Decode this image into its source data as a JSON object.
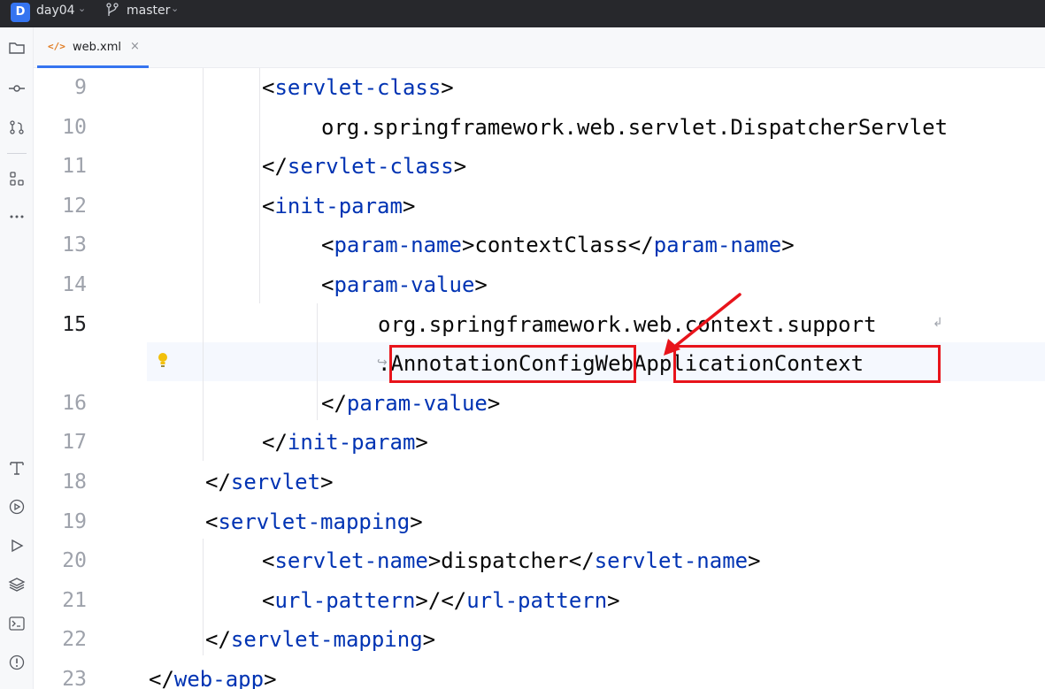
{
  "titlebar": {
    "project_badge": "D",
    "project_name": "day04",
    "branch": "master"
  },
  "tabs": [
    {
      "icon": "</>",
      "label": "web.xml",
      "close": "×"
    }
  ],
  "editor": {
    "line_numbers": [
      "9",
      "10",
      "11",
      "12",
      "13",
      "14",
      "15",
      "",
      "16",
      "17",
      "18",
      "19",
      "20",
      "21",
      "22",
      "23"
    ],
    "lines": [
      {
        "n": "9",
        "open": "<",
        "tag": "servlet-class",
        "close": ">"
      },
      {
        "n": "10",
        "text": "org.springframework.web.servlet.DispatcherServlet"
      },
      {
        "n": "11",
        "open": "</",
        "tag": "servlet-class",
        "close": ">"
      },
      {
        "n": "12",
        "open": "<",
        "tag": "init-param",
        "close": ">"
      },
      {
        "n": "13",
        "t1": "param-name",
        "text": "contextClass",
        "t2": "param-name"
      },
      {
        "n": "14",
        "open": "<",
        "tag": "param-value",
        "close": ">"
      },
      {
        "n": "15",
        "text": "org.springframework.web.context.support"
      },
      {
        "n": "",
        "text": ".AnnotationConfigWebApplicationContext"
      },
      {
        "n": "16",
        "open": "</",
        "tag": "param-value",
        "close": ">"
      },
      {
        "n": "17",
        "open": "</",
        "tag": "init-param",
        "close": ">"
      },
      {
        "n": "18",
        "open": "</",
        "tag": "servlet",
        "close": ">"
      },
      {
        "n": "19",
        "open": "<",
        "tag": "servlet-mapping",
        "close": ">"
      },
      {
        "n": "20",
        "t1": "servlet-name",
        "text": "dispatcher",
        "t2": "servlet-name"
      },
      {
        "n": "21",
        "t1": "url-pattern",
        "text": "/",
        "t2": "url-pattern"
      },
      {
        "n": "22",
        "open": "</",
        "tag": "servlet-mapping",
        "close": ">"
      },
      {
        "n": "23",
        "open": "</",
        "tag": "web-app",
        "close": ">"
      }
    ]
  },
  "annotations": {
    "highlight_color": "#e8141b",
    "highlight_1": ".AnnotationConfig",
    "highlight_2": "ApplicationContext"
  },
  "colors": {
    "tag": "#0033b3",
    "text": "#080808",
    "line_number": "#9ea2ab",
    "accent": "#3574f0"
  }
}
